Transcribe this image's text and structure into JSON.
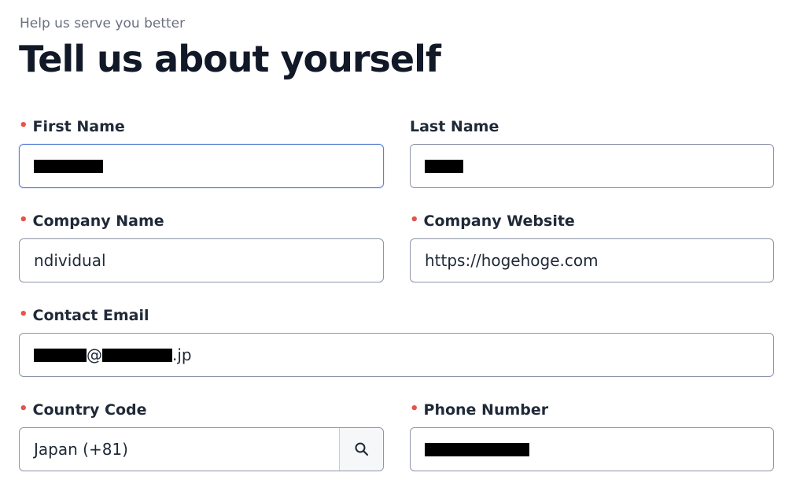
{
  "header": {
    "subtitle": "Help us serve you better",
    "title": "Tell us about yourself"
  },
  "form": {
    "first_name": {
      "label": "First Name",
      "required": true,
      "value_redacted": true
    },
    "last_name": {
      "label": "Last Name",
      "required": false,
      "value_redacted": true
    },
    "company_name": {
      "label": "Company Name",
      "required": true,
      "value": "ndividual"
    },
    "company_website": {
      "label": "Company Website",
      "required": true,
      "value": "https://hogehoge.com"
    },
    "contact_email": {
      "label": "Contact Email",
      "required": true,
      "at_sign": "@",
      "domain_suffix": ".jp",
      "value_partially_redacted": true
    },
    "country_code": {
      "label": "Country Code",
      "required": true,
      "value": "Japan (+81)",
      "button_icon": "search-icon"
    },
    "phone_number": {
      "label": "Phone Number",
      "required": true,
      "value_redacted": true
    }
  },
  "colors": {
    "required_marker": "#e5534b",
    "focus_border": "#5b7fd6",
    "input_border": "#8f95a8",
    "title_text": "#111827",
    "subtitle_text": "#6b7080"
  }
}
